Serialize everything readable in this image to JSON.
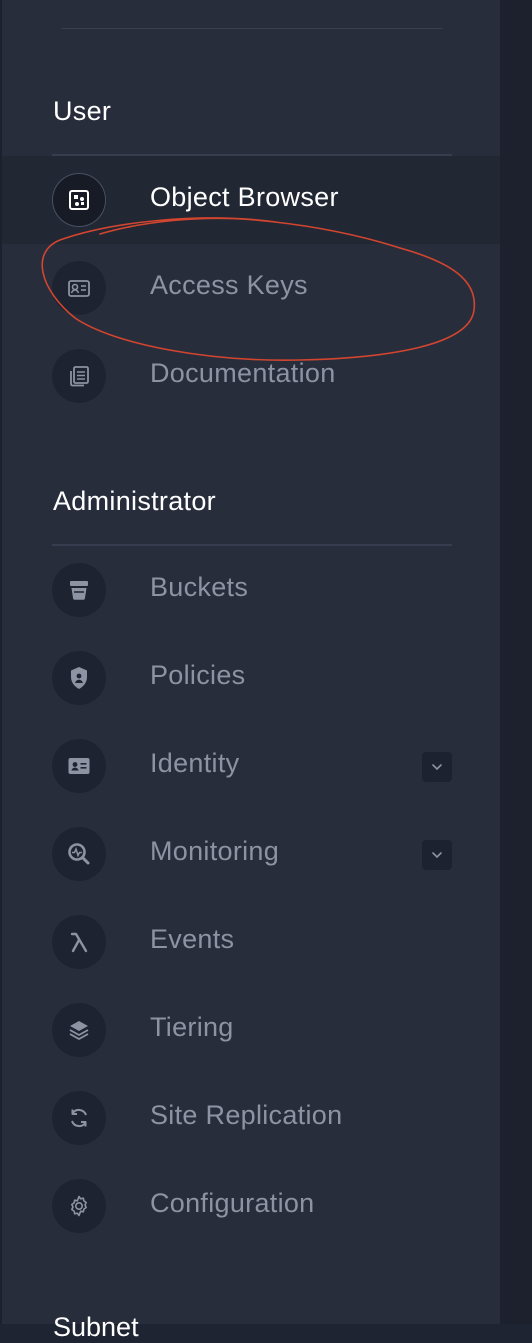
{
  "sections": {
    "user": {
      "title": "User",
      "items": [
        {
          "label": "Object Browser",
          "icon": "object-browser-icon",
          "active": true
        },
        {
          "label": "Access Keys",
          "icon": "access-keys-icon",
          "active": false
        },
        {
          "label": "Documentation",
          "icon": "documentation-icon",
          "active": false
        }
      ]
    },
    "administrator": {
      "title": "Administrator",
      "items": [
        {
          "label": "Buckets",
          "icon": "bucket-icon"
        },
        {
          "label": "Policies",
          "icon": "policy-shield-icon"
        },
        {
          "label": "Identity",
          "icon": "identity-card-icon",
          "expandable": true
        },
        {
          "label": "Monitoring",
          "icon": "monitoring-icon",
          "expandable": true
        },
        {
          "label": "Events",
          "icon": "lambda-icon"
        },
        {
          "label": "Tiering",
          "icon": "layers-icon"
        },
        {
          "label": "Site Replication",
          "icon": "sync-icon"
        },
        {
          "label": "Configuration",
          "icon": "gear-icon"
        }
      ]
    },
    "next_section_partial": "Subnet"
  },
  "colors": {
    "sidebar_bg": "#282d3c",
    "active_bg": "#222734",
    "label_inactive": "#8c93a3",
    "label_active": "#ffffff",
    "annotation_stroke": "#d2452f"
  }
}
